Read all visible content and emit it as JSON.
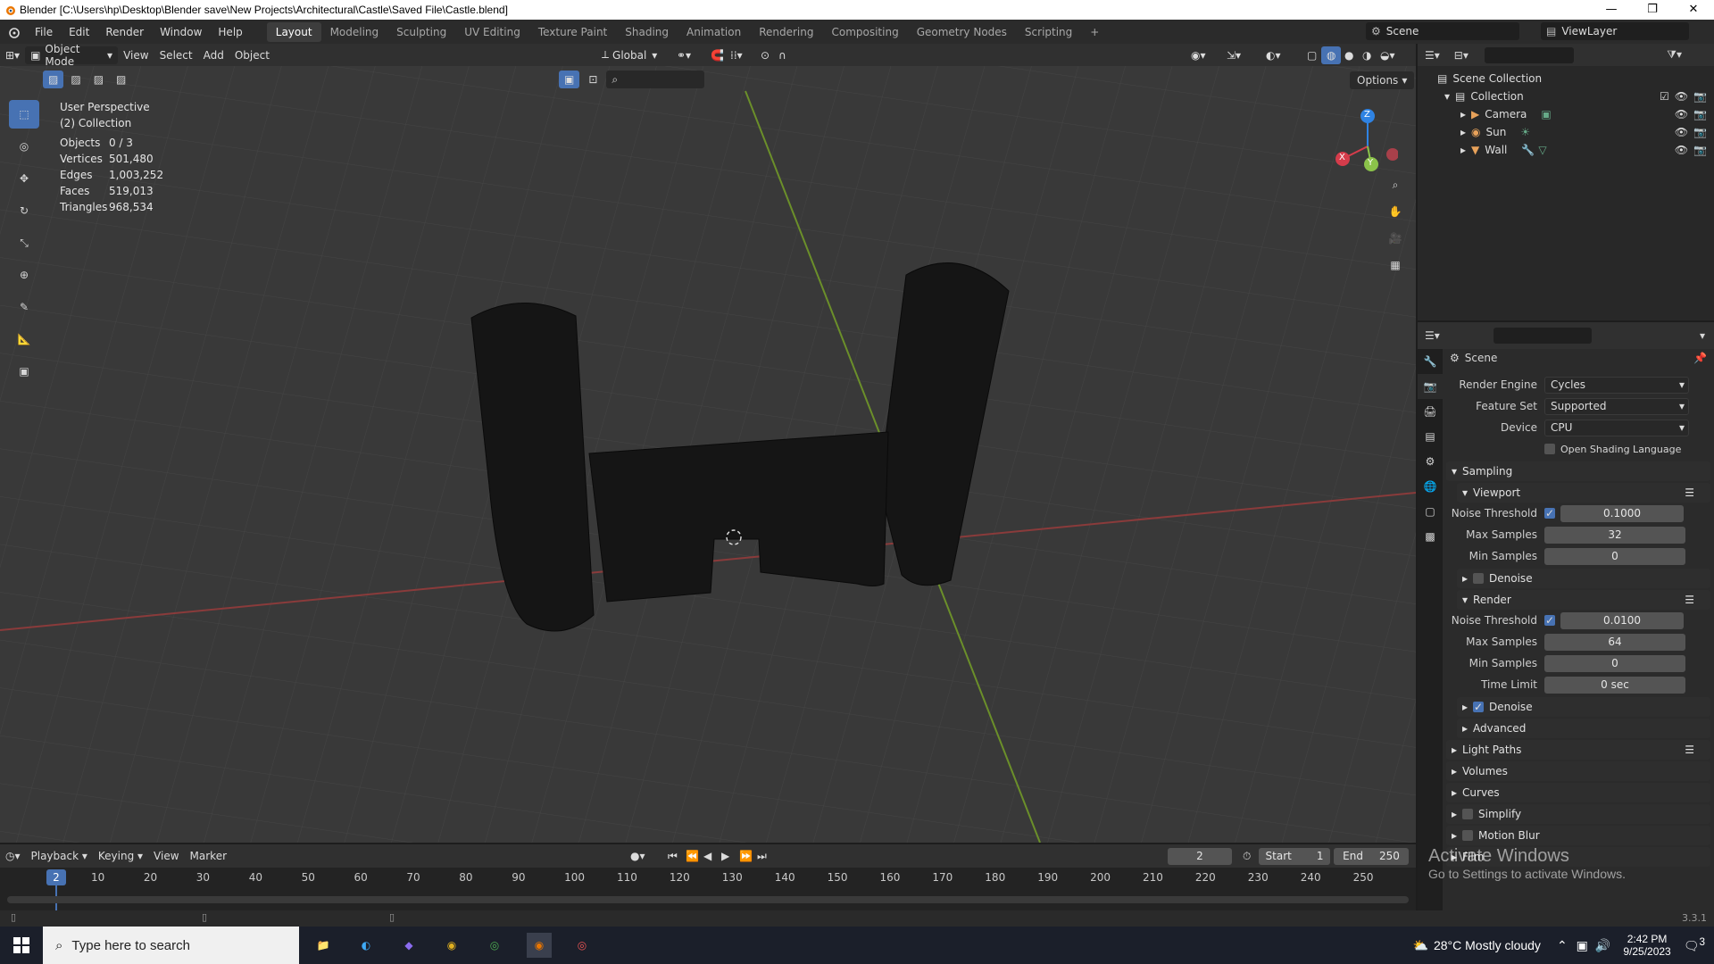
{
  "titlebar": {
    "title": "Blender [C:\\Users\\hp\\Desktop\\Blender save\\New Projects\\Architectural\\Castle\\Saved File\\Castle.blend]",
    "minimize": "—",
    "maximize": "❐",
    "close": "✕"
  },
  "menu": {
    "items": [
      "File",
      "Edit",
      "Render",
      "Window",
      "Help"
    ],
    "workspaces": [
      "Layout",
      "Modeling",
      "Sculpting",
      "UV Editing",
      "Texture Paint",
      "Shading",
      "Animation",
      "Rendering",
      "Compositing",
      "Geometry Nodes",
      "Scripting"
    ],
    "add_workspace": "+",
    "scene": "Scene",
    "view_layer": "ViewLayer"
  },
  "viewport_header": {
    "mode": "Object Mode",
    "menus": [
      "View",
      "Select",
      "Add",
      "Object"
    ],
    "orientation": "Global",
    "options": "Options"
  },
  "overlay": {
    "perspective": "User Perspective",
    "collection": "(2) Collection",
    "stats": [
      {
        "label": "Objects",
        "value": "0 / 3"
      },
      {
        "label": "Vertices",
        "value": "501,480"
      },
      {
        "label": "Edges",
        "value": "1,003,252"
      },
      {
        "label": "Faces",
        "value": "519,013"
      },
      {
        "label": "Triangles",
        "value": "968,534"
      }
    ]
  },
  "gizmo": {
    "x": "X",
    "y": "Y",
    "z": "Z"
  },
  "outliner": {
    "root": "Scene Collection",
    "collection": "Collection",
    "objects": [
      "Camera",
      "Sun",
      "Wall"
    ]
  },
  "properties": {
    "context": "Scene",
    "render_engine_label": "Render Engine",
    "render_engine": "Cycles",
    "feature_set_label": "Feature Set",
    "feature_set": "Supported",
    "device_label": "Device",
    "device": "CPU",
    "osl_label": "Open Shading Language",
    "sampling": "Sampling",
    "viewport": {
      "title": "Viewport",
      "noise_threshold_label": "Noise Threshold",
      "noise_threshold": "0.1000",
      "max_samples_label": "Max Samples",
      "max_samples": "32",
      "min_samples_label": "Min Samples",
      "min_samples": "0",
      "denoise": "Denoise"
    },
    "render": {
      "title": "Render",
      "noise_threshold_label": "Noise Threshold",
      "noise_threshold": "0.0100",
      "max_samples_label": "Max Samples",
      "max_samples": "64",
      "min_samples_label": "Min Samples",
      "min_samples": "0",
      "time_limit_label": "Time Limit",
      "time_limit": "0 sec",
      "denoise": "Denoise"
    },
    "advanced": "Advanced",
    "panels": [
      "Light Paths",
      "Volumes",
      "Curves",
      "Simplify",
      "Motion Blur",
      "Film"
    ]
  },
  "timeline": {
    "menus": [
      "Playback",
      "Keying",
      "View",
      "Marker"
    ],
    "current_frame": "2",
    "start_label": "Start",
    "start": "1",
    "end_label": "End",
    "end": "250",
    "ticks": [
      "10",
      "20",
      "30",
      "40",
      "50",
      "60",
      "70",
      "80",
      "90",
      "100",
      "110",
      "120",
      "130",
      "140",
      "150",
      "160",
      "170",
      "180",
      "190",
      "200",
      "210",
      "220",
      "230",
      "240",
      "250"
    ]
  },
  "statusbar": {
    "version": "3.3.1"
  },
  "watermark": {
    "line1": "Activate Windows",
    "line2": "Go to Settings to activate Windows."
  },
  "taskbar": {
    "search_placeholder": "Type here to search",
    "weather": "28°C  Mostly cloudy",
    "time": "2:42 PM",
    "date": "9/25/2023",
    "notifications": "3"
  }
}
